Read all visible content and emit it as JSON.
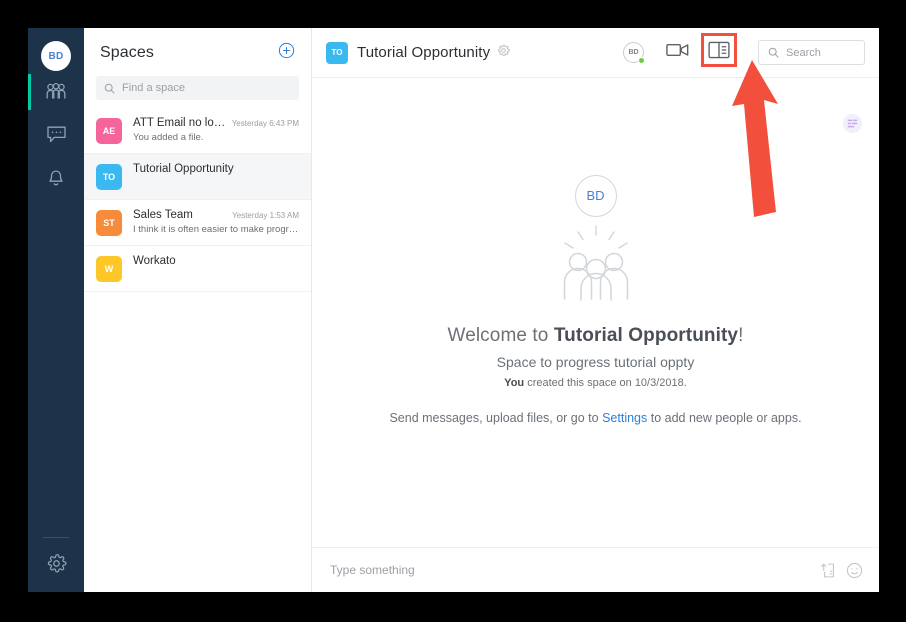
{
  "nav_rail": {
    "avatar_initials": "BD",
    "items": [
      {
        "icon": "people-icon",
        "name": "spaces",
        "active": true
      },
      {
        "icon": "chat-bubble-icon",
        "name": "messages",
        "active": false
      },
      {
        "icon": "bell-icon",
        "name": "notifications",
        "active": false
      }
    ],
    "settings_icon": "gear-icon"
  },
  "sidebar": {
    "title": "Spaces",
    "add_button_icon": "plus-circle-icon",
    "search": {
      "placeholder": "Find a space",
      "value": "",
      "icon": "search-icon"
    },
    "spaces": [
      {
        "initials": "AE",
        "color": "#f5649b",
        "name": "ATT Email no longe…",
        "time": "Yesterday 6:43 PM",
        "preview": "You added a file.",
        "selected": false
      },
      {
        "initials": "TO",
        "color": "#3ab8f0",
        "name": "Tutorial Opportunity",
        "time": "",
        "preview": "",
        "selected": true
      },
      {
        "initials": "ST",
        "color": "#f68b3c",
        "name": "Sales Team",
        "time": "Yesterday 1:53 AM",
        "preview": "I think it is often easier to make progress …",
        "selected": false
      },
      {
        "initials": "W",
        "color": "#fcc727",
        "name": "Workato",
        "time": "",
        "preview": "",
        "selected": false
      }
    ]
  },
  "header": {
    "space_initials": "TO",
    "title": "Tutorial Opportunity",
    "gear_icon": "gear-icon",
    "presence_initials": "BD",
    "presence_status_color": "#6fcc3a",
    "video_call_icon": "video-camera-icon",
    "panel_toggle_icon": "sidebar-panel-icon",
    "search": {
      "placeholder": "Search",
      "value": "",
      "icon": "search-icon"
    }
  },
  "content": {
    "avatar_initials": "BD",
    "illustration": "three-people-icon",
    "welcome_prefix": "Welcome to ",
    "welcome_space": "Tutorial Opportunity",
    "welcome_suffix": "!",
    "subtitle": "Space to progress tutorial oppty",
    "created_by": "You",
    "created_text": " created this space on 10/3/2018.",
    "hint_before": "Send messages, upload files, or go to ",
    "hint_link": "Settings",
    "hint_after": " to add new people or apps.",
    "corner_badge_icon": "bot-badge-icon"
  },
  "composer": {
    "placeholder": "Type something",
    "value": "",
    "attach_icon": "upload-file-icon",
    "emoji_icon": "smiley-icon"
  },
  "annotation": {
    "highlight_color": "#f2503c",
    "arrow_target": "panel-toggle-button"
  }
}
